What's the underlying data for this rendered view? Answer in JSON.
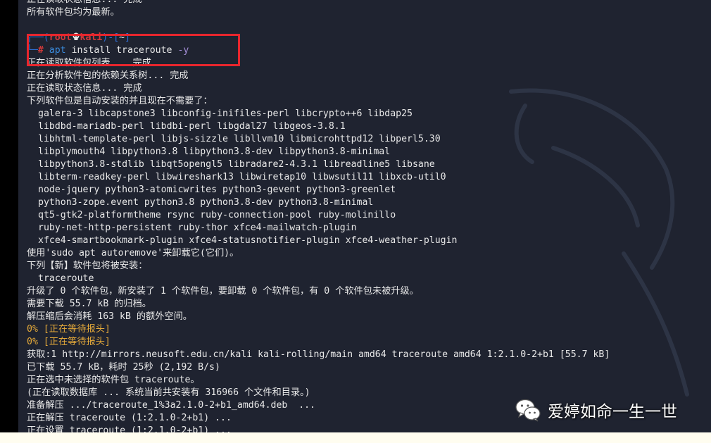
{
  "terminal": {
    "lines": [
      "正在读取状态信息... 完成",
      "所有软件包均为最新。",
      "",
      "",
      "",
      "正在读取软件包列表... 完成",
      "正在分析软件包的依赖关系树... 完成",
      "正在读取状态信息... 完成",
      "下列软件包是自动安装的并且现在不需要了：",
      "galera-3 libcapstone3 libconfig-inifiles-perl libcrypto++6 libdap25",
      "libdbd-mariadb-perl libdbi-perl libgdal27 libgeos-3.8.1",
      "libhtml-template-perl libjs-sizzle libllvm10 libmicrohttpd12 libperl5.30",
      "libplymouth4 libpython3.8 libpython3.8-dev libpython3.8-minimal",
      "libpython3.8-stdlib libqt5opengl5 libradare2-4.3.1 libreadline5 libsane",
      "libterm-readkey-perl libwireshark13 libwiretap10 libwsutil11 libxcb-util0",
      "node-jquery python3-atomicwrites python3-gevent python3-greenlet",
      "python3-zope.event python3.8 python3.8-dev python3.8-minimal",
      "qt5-gtk2-platformtheme rsync ruby-connection-pool ruby-molinillo",
      "ruby-net-http-persistent ruby-thor xfce4-mailwatch-plugin",
      "xfce4-smartbookmark-plugin xfce4-statusnotifier-plugin xfce4-weather-plugin",
      "使用'sudo apt autoremove'来卸载它(它们)。",
      "下列【新】软件包将被安装：",
      "traceroute",
      "升级了 0 个软件包，新安装了 1 个软件包，要卸载 0 个软件包，有 0 个软件包未被升级。",
      "需要下载 55.7 kB 的归档。",
      "解压缩后会消耗 163 kB 的额外空间。",
      "0% [正在等待报头]",
      "0% [正在等待报头]",
      "获取:1 http://mirrors.neusoft.edu.cn/kali kali-rolling/main amd64 traceroute amd64 1:2.1.0-2+b1 [55.7 kB]",
      "已下载 55.7 kB，耗时 25秒 (2,192 B/s)",
      "正在选中未选择的软件包 traceroute。",
      "(正在读取数据库 ... 系统当前共安装有 316966 个文件和目录。)",
      "准备解压 .../traceroute_1%3a2.1.0-2+b1_amd64.deb  ...",
      "正在解压 traceroute (1:2.1.0-2+b1) ...",
      "正在设置 traceroute (1:2.1.0-2+b1) ..."
    ],
    "prompt": {
      "top_left": "┌──(",
      "user": "root",
      "host": "kali",
      "top_mid": ")-[",
      "dir": "~",
      "top_right": "]",
      "bottom": "└─",
      "hash": "#",
      "command": "apt",
      "args": "install traceroute",
      "flag": "-y"
    }
  },
  "watermark": {
    "text": "爱婷如命一生一世",
    "icon": "wechat-icon"
  },
  "colors": {
    "terminal_bg": "#1f2330",
    "highlight_border": "#e8262d",
    "warn_text": "#e4a93a",
    "prompt_blue": "#2f6fd6",
    "prompt_red": "#d43a3a"
  }
}
